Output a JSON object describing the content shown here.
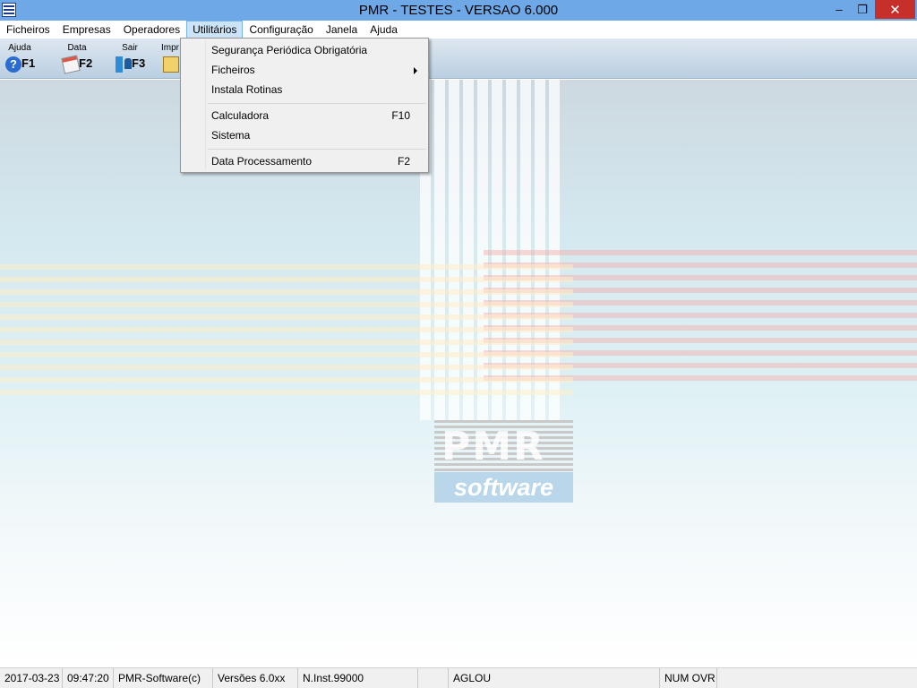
{
  "window": {
    "title": "PMR - TESTES - VERSAO 6.000",
    "minimize_glyph": "–",
    "restore_glyph": "❐",
    "close_glyph": "✕"
  },
  "menubar": {
    "items": [
      {
        "label": "Ficheiros"
      },
      {
        "label": "Empresas"
      },
      {
        "label": "Operadores"
      },
      {
        "label": "Utilitários",
        "active": true
      },
      {
        "label": "Configuração"
      },
      {
        "label": "Janela"
      },
      {
        "label": "Ajuda"
      }
    ]
  },
  "toolbar": {
    "help": {
      "label": "Ajuda",
      "key": "F1",
      "icon": "help-icon"
    },
    "date": {
      "label": "Data",
      "key": "F2",
      "icon": "calendar-icon"
    },
    "exit": {
      "label": "Sair",
      "key": "F3",
      "icon": "exit-icon"
    },
    "print": {
      "label": "Impr",
      "icon": "print-icon"
    }
  },
  "dropdown": {
    "items": [
      {
        "label": "Segurança Periódica Obrigatória",
        "shortcut": ""
      },
      {
        "label": "Ficheiros",
        "shortcut": "",
        "submenu": true
      },
      {
        "label": "Instala Rotinas",
        "shortcut": ""
      },
      {
        "label": "Calculadora",
        "shortcut": "F10"
      },
      {
        "label": "Sistema",
        "shortcut": ""
      },
      {
        "label": "Data Processamento",
        "shortcut": "F2"
      }
    ]
  },
  "logo": {
    "brand": "PMR",
    "tagline": "software"
  },
  "statusbar": {
    "date": "2017-03-23",
    "time": "09:47:20",
    "company": "PMR-Software(c)",
    "version": "Versões 6.0xx",
    "install": "N.Inst.99000",
    "empty1": "",
    "user": "AGLOU",
    "empty2": "",
    "keys": "NUM OVR"
  },
  "colors": {
    "titlebar": "#6ea8e6",
    "close_button": "#c7302a",
    "menu_highlight": "#cce4f7"
  }
}
